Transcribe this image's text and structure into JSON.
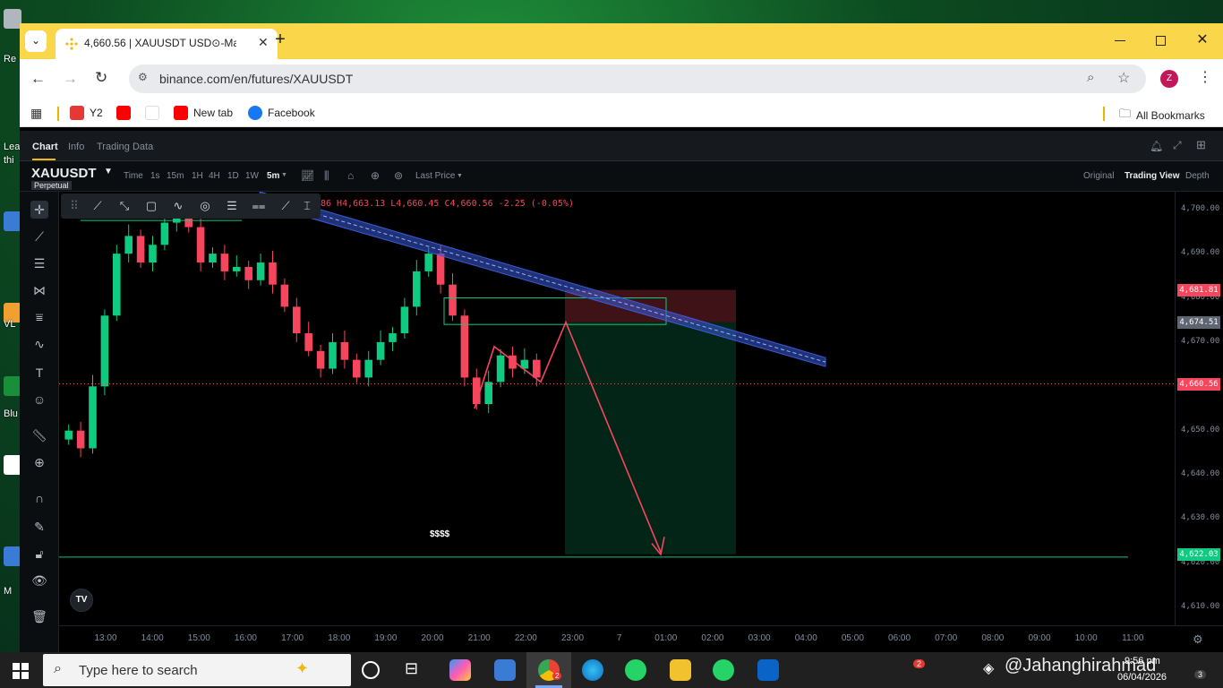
{
  "desktop": {
    "labels": [
      "Re",
      "Lea",
      "thi",
      "VL",
      "Blu",
      "M"
    ]
  },
  "browser": {
    "tab": {
      "title": "4,660.56 | XAUUSDT USD⊙-Ma"
    },
    "url": "binance.com/en/futures/XAUUSDT",
    "profile_initial": "Z",
    "bookmarks": [
      {
        "label": "Y2",
        "color": "#e53935"
      },
      {
        "label": "",
        "color": "#ff0000"
      },
      {
        "label": "",
        "color": "#ffffff"
      },
      {
        "label": "New tab",
        "color": "#ff0000"
      },
      {
        "label": "Facebook",
        "color": "#1877f2"
      }
    ],
    "all_bookmarks": "All Bookmarks"
  },
  "app": {
    "tabs": [
      "Chart",
      "Info",
      "Trading Data"
    ],
    "symbol": "XAUUSDT",
    "badge": "Perpetual",
    "intervals": [
      "Time",
      "1s",
      "15m",
      "1H",
      "4H",
      "1D",
      "1W",
      "5m"
    ],
    "price_type": "Last Price",
    "views": [
      "Original",
      "Trading View",
      "Depth"
    ],
    "ohlc": "86 H4,663.13 L4,660.45 C4,660.56 -2.25 (-0.05%)",
    "target_label": "$$$$"
  },
  "chart_data": {
    "type": "candlestick",
    "symbol": "XAUUSDT",
    "interval": "5m",
    "ylim": [
      4606,
      4704
    ],
    "yticks": [
      "4,700.00",
      "4,690.00",
      "4,680.00",
      "4,670.00",
      "4,660.00",
      "4,650.00",
      "4,640.00",
      "4,630.00",
      "4,620.00",
      "4,610.00"
    ],
    "xticks": [
      "13:00",
      "14:00",
      "15:00",
      "16:00",
      "17:00",
      "18:00",
      "19:00",
      "20:00",
      "21:00",
      "22:00",
      "23:00",
      "7",
      "01:00",
      "02:00",
      "03:00",
      "04:00",
      "05:00",
      "06:00",
      "07:00",
      "08:00",
      "09:00",
      "10:00",
      "11:00"
    ],
    "price_labels": [
      {
        "value": "4,681.81",
        "color": "#f6465d"
      },
      {
        "value": "4,674.51",
        "color": "#5e6673"
      },
      {
        "value": "4,660.56",
        "color": "#f6465d"
      },
      {
        "value": "4,622.03",
        "color": "#0ecb81"
      }
    ],
    "close_series": [
      4650,
      4646,
      4660,
      4676,
      4690,
      4694,
      4688,
      4692,
      4697,
      4700,
      4696,
      4688,
      4690,
      4686,
      4687,
      4684,
      4688,
      4683,
      4678,
      4672,
      4668,
      4664,
      4670,
      4666,
      4662,
      4666,
      4670,
      4672,
      4678,
      4686,
      4690,
      4683,
      4676,
      4662,
      4656,
      4661,
      4667,
      4664,
      4666,
      4662
    ],
    "trade": {
      "entry": 4674.51,
      "stop": 4681.81,
      "target": 4622.03
    },
    "colors": {
      "up": "#0ecb81",
      "down": "#f6465d",
      "trendline": "#3a5bd9"
    }
  },
  "taskbar": {
    "search_placeholder": "Type here to search",
    "watermark": "@Jahanghirahmad",
    "date": "06/04/2026",
    "time": "9:56 pm",
    "notif_count": "2",
    "chrome_badge": "2",
    "notif_center": "3"
  }
}
